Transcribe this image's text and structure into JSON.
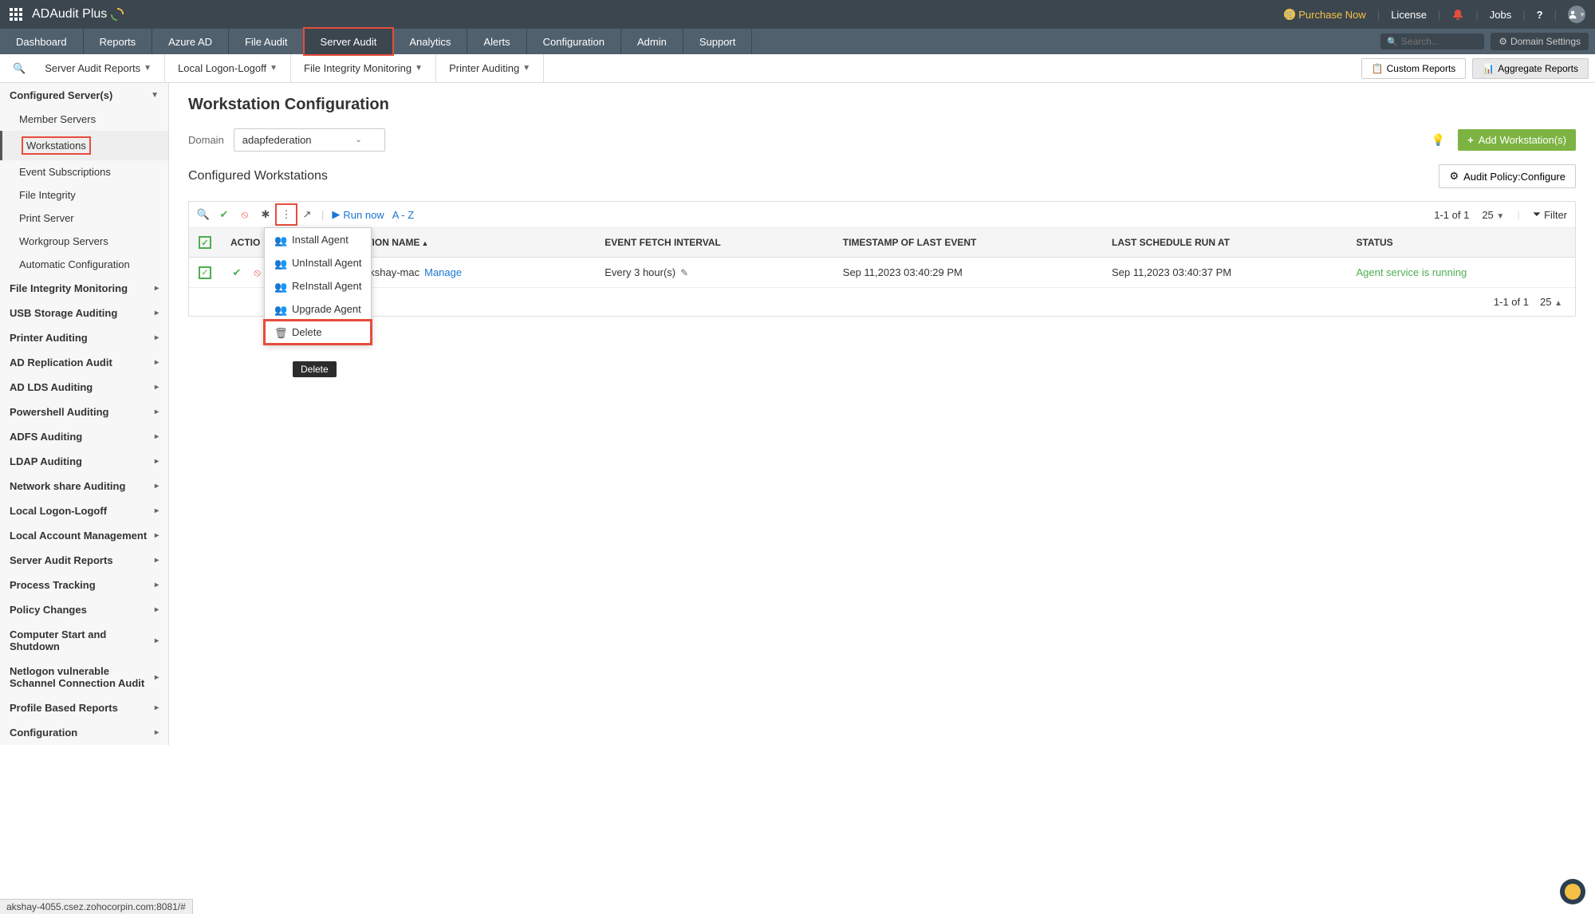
{
  "app": {
    "title": "ADAudit Plus"
  },
  "topbar": {
    "purchase": "Purchase Now",
    "license": "License",
    "jobs": "Jobs"
  },
  "mainNav": [
    "Dashboard",
    "Reports",
    "Azure AD",
    "File Audit",
    "Server Audit",
    "Analytics",
    "Alerts",
    "Configuration",
    "Admin",
    "Support"
  ],
  "mainNavActive": "Server Audit",
  "search": {
    "placeholder": "Search..."
  },
  "domainSettings": "Domain Settings",
  "subNav": [
    "Server Audit Reports",
    "Local Logon-Logoff",
    "File Integrity Monitoring",
    "Printer Auditing"
  ],
  "customReports": "Custom Reports",
  "aggregateReports": "Aggregate Reports",
  "sidebar": {
    "header": "Configured Server(s)",
    "items": [
      "Member Servers",
      "Workstations",
      "Event Subscriptions",
      "File Integrity",
      "Print Server",
      "Workgroup Servers",
      "Automatic Configuration"
    ],
    "activeItem": "Workstations",
    "groups": [
      "File Integrity Monitoring",
      "USB Storage Auditing",
      "Printer Auditing",
      "AD Replication Audit",
      "AD LDS Auditing",
      "Powershell Auditing",
      "ADFS Auditing",
      "LDAP Auditing",
      "Network share Auditing",
      "Local Logon-Logoff",
      "Local Account Management",
      "Server Audit Reports",
      "Process Tracking",
      "Policy Changes",
      "Computer Start and Shutdown",
      "Netlogon vulnerable Schannel Connection Audit",
      "Profile Based Reports",
      "Configuration"
    ]
  },
  "page": {
    "title": "Workstation Configuration",
    "domainLabel": "Domain",
    "domainValue": "adapfederation",
    "addBtn": "Add Workstation(s)",
    "sectionTitle": "Configured Workstations",
    "auditPolicyBtn": "Audit Policy:Configure"
  },
  "tableToolbar": {
    "runNow": "Run now",
    "az": "A - Z",
    "paginationTop": "1-1 of 1",
    "pageSize": "25",
    "filter": "Filter"
  },
  "dropdown": {
    "items": [
      "Install Agent",
      "UnInstall Agent",
      "ReInstall Agent",
      "Upgrade Agent",
      "Delete"
    ],
    "tooltip": "Delete"
  },
  "columns": [
    "ACTIO",
    "WORKSTATION NAME",
    "EVENT FETCH INTERVAL",
    "TIMESTAMP OF LAST EVENT",
    "LAST SCHEDULE RUN AT",
    "STATUS"
  ],
  "rows": [
    {
      "name": "adap-akshay-mac",
      "manage": "Manage",
      "interval": "Every 3 hour(s)",
      "lastEvent": "Sep 11,2023 03:40:29 PM",
      "lastSchedule": "Sep 11,2023 03:40:37 PM",
      "status": "Agent service is running"
    }
  ],
  "paginationBottom": {
    "range": "1-1 of 1",
    "size": "25"
  },
  "statusUrl": "akshay-4055.csez.zohocorpin.com:8081/#"
}
